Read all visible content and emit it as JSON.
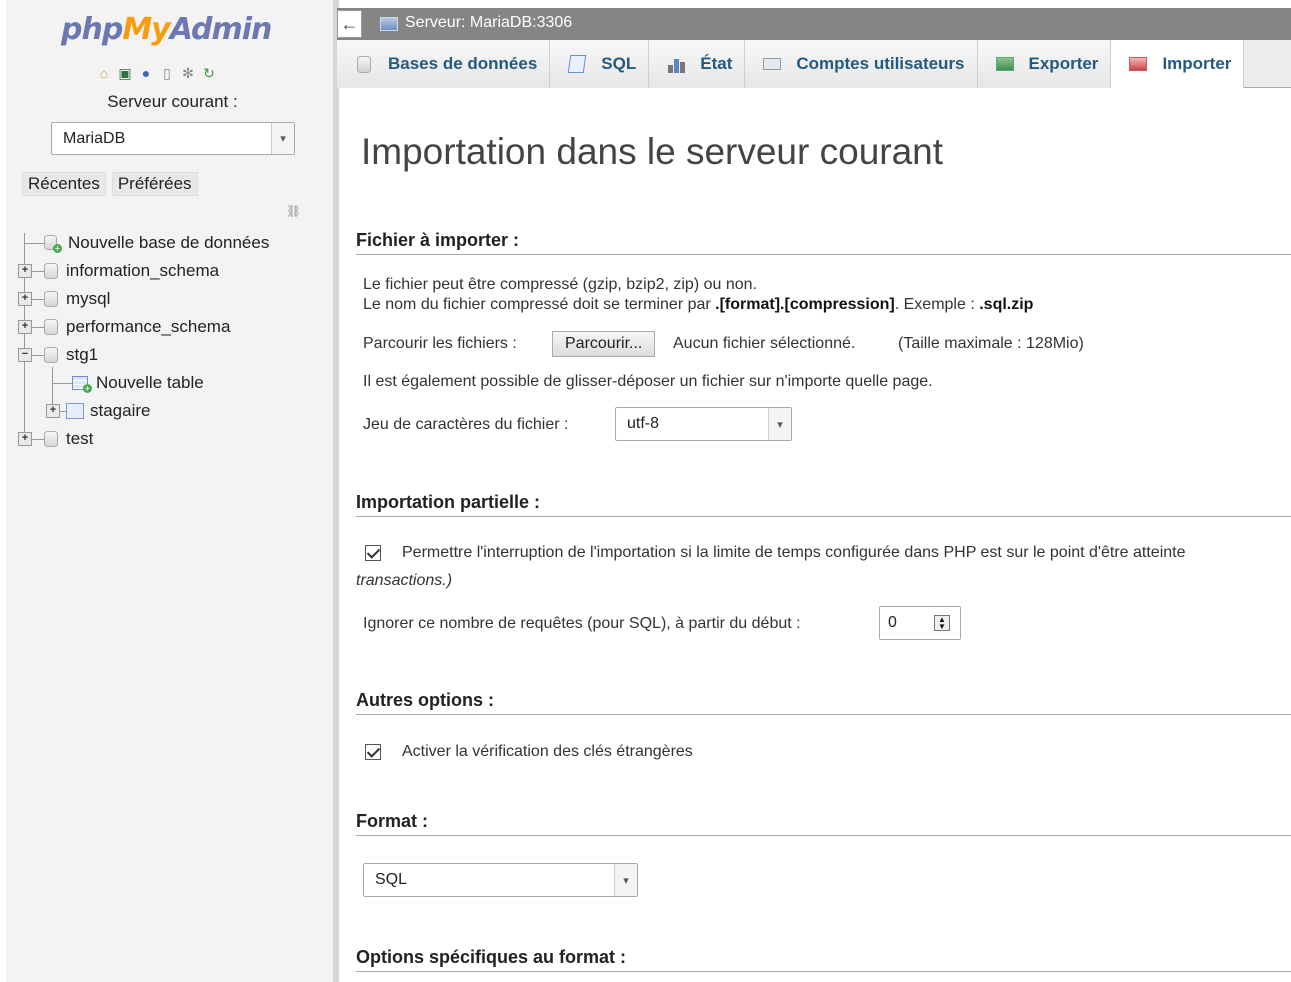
{
  "sidebar": {
    "logo_php": "php",
    "logo_my": "My",
    "logo_admin": "Admin",
    "quick_icons": [
      "home-icon",
      "exit-icon",
      "help-icon",
      "docs-icon",
      "settings-icon",
      "reload-icon"
    ],
    "server_label": "Serveur courant :",
    "server_select": "MariaDB",
    "recent_label": "Récentes",
    "favorites_label": "Préférées",
    "tree": {
      "new_db": "Nouvelle base de données",
      "databases": [
        {
          "name": "information_schema",
          "expanded": false
        },
        {
          "name": "mysql",
          "expanded": false
        },
        {
          "name": "performance_schema",
          "expanded": false
        },
        {
          "name": "stg1",
          "expanded": true
        },
        {
          "name": "test",
          "expanded": false
        }
      ],
      "stg1_children": {
        "new_table": "Nouvelle table",
        "view": "stagaire"
      }
    }
  },
  "topbar": {
    "back": "←",
    "server_title": "Serveur: MariaDB:3306"
  },
  "tabs": [
    {
      "label": "Bases de données",
      "icon": "database-icon"
    },
    {
      "label": "SQL",
      "icon": "sql-icon"
    },
    {
      "label": "État",
      "icon": "status-icon"
    },
    {
      "label": "Comptes utilisateurs",
      "icon": "users-icon"
    },
    {
      "label": "Exporter",
      "icon": "export-icon"
    },
    {
      "label": "Importer",
      "icon": "import-icon",
      "active": true
    }
  ],
  "main": {
    "title": "Importation dans le serveur courant",
    "file_section": {
      "heading": "Fichier à importer :",
      "line1": "Le fichier peut être compressé (gzip, bzip2, zip) ou non.",
      "line2_pre": "Le nom du fichier compressé doit se terminer par ",
      "line2_bold": ".[format].[compression]",
      "line2_mid": ". Exemple : ",
      "line2_example": ".sql.zip",
      "browse_label": "Parcourir les fichiers :",
      "browse_button": "Parcourir...",
      "no_file": "Aucun fichier sélectionné.",
      "max_size": "(Taille maximale : 128Mio)",
      "drag_drop": "Il est également possible de glisser-déposer un fichier sur n'importe quelle page.",
      "charset_label": "Jeu de caractères du fichier :",
      "charset_value": "utf-8"
    },
    "partial_section": {
      "heading": "Importation partielle :",
      "interrupt_label": "Permettre l'interruption de l'importation si la limite de temps configurée dans PHP est sur le point d'être atteinte",
      "interrupt_checked": true,
      "interrupt_tail": "transactions.)",
      "skip_label": "Ignorer ce nombre de requêtes (pour SQL), à partir du début :",
      "skip_value": "0"
    },
    "other_section": {
      "heading": "Autres options :",
      "fk_label": "Activer la vérification des clés étrangères",
      "fk_checked": true
    },
    "format_section": {
      "heading": "Format :",
      "format_value": "SQL"
    },
    "format_specific_heading": "Options spécifiques au format :"
  }
}
